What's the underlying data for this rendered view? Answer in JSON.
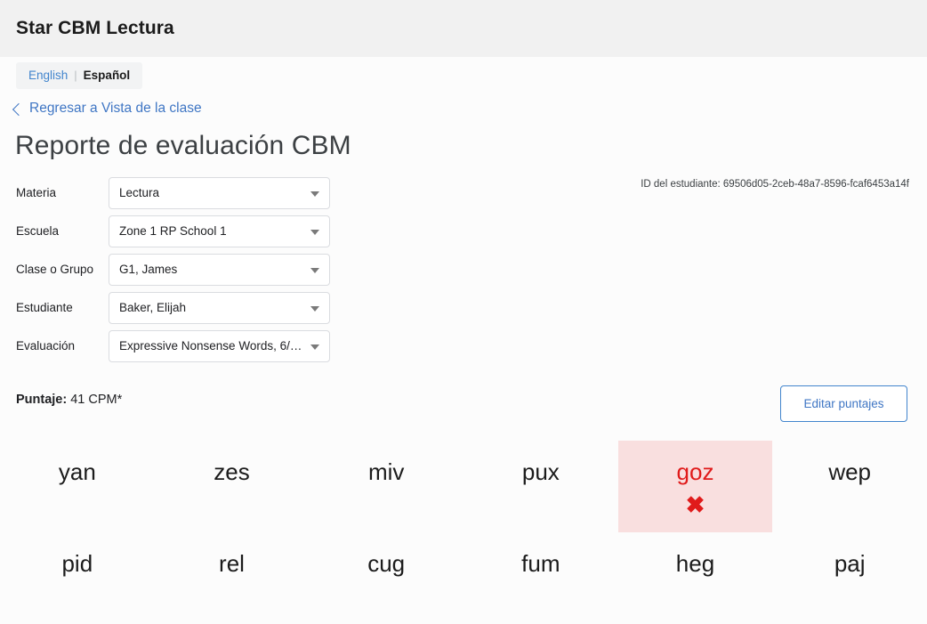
{
  "header": {
    "app_title": "Star CBM Lectura"
  },
  "language_switcher": {
    "english_label": "English",
    "separator": "|",
    "spanish_label": "Español"
  },
  "back_link": {
    "label": "Regresar a Vista de la clase",
    "icon": "chevron-left-icon"
  },
  "page_title": "Reporte de evaluación CBM",
  "student_id_line": "ID del estudiante: 69506d05-2ceb-48a7-8596-fcaf6453a14f",
  "form": {
    "fields": [
      {
        "label": "Materia",
        "value": "Lectura"
      },
      {
        "label": "Escuela",
        "value": "Zone 1 RP School 1"
      },
      {
        "label": "Clase o Grupo",
        "value": "G1, James"
      },
      {
        "label": "Estudiante",
        "value": "Baker, Elijah"
      },
      {
        "label": "Evaluación",
        "value": "Expressive Nonsense Words, 6/…"
      }
    ]
  },
  "score": {
    "label": "Puntaje:",
    "value": "41 CPM*"
  },
  "edit_button_label": "Editar puntajes",
  "word_grid": {
    "columns": 6,
    "wrong_mark": "✖",
    "cells": [
      {
        "word": "yan",
        "status": "correct"
      },
      {
        "word": "zes",
        "status": "correct"
      },
      {
        "word": "miv",
        "status": "correct"
      },
      {
        "word": "pux",
        "status": "correct"
      },
      {
        "word": "goz",
        "status": "incorrect"
      },
      {
        "word": "wep",
        "status": "correct"
      },
      {
        "word": "pid",
        "status": "correct"
      },
      {
        "word": "rel",
        "status": "correct"
      },
      {
        "word": "cug",
        "status": "correct"
      },
      {
        "word": "fum",
        "status": "correct"
      },
      {
        "word": "heg",
        "status": "correct"
      },
      {
        "word": "paj",
        "status": "correct"
      }
    ]
  },
  "colors": {
    "header_bg": "#f1f1f1",
    "link_blue": "#3f76c4",
    "error_red": "#e01b1b",
    "error_bg": "#f9dfdf"
  }
}
